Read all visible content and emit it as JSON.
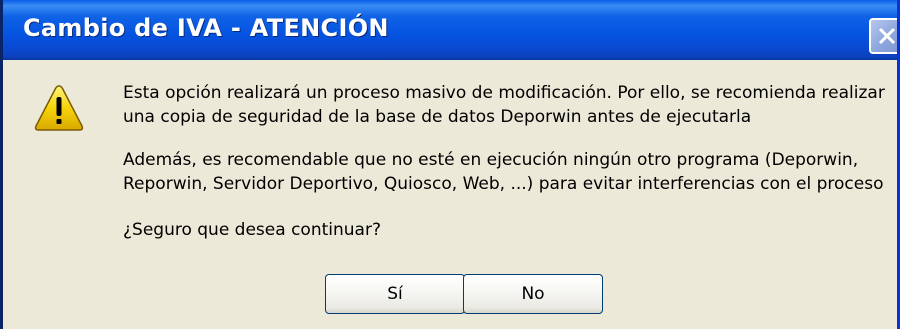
{
  "window": {
    "title": "Cambio de IVA - ATENCIÓN",
    "close_icon": "close-icon"
  },
  "message": {
    "icon": "warning-icon",
    "paragraph1": [
      "Esta opción realizará un proceso masivo de modificación. Por ello, se recomienda realizar",
      "una copia de seguridad de la base de datos Deporwin antes de ejecutarla"
    ],
    "paragraph2": [
      "Además, es recomendable que no esté en ejecución ningún otro programa (Deporwin,",
      "Reporwin, Servidor Deportivo, Quiosco, Web, ...) para evitar interferencias con el proceso"
    ],
    "question": "¿Seguro que desea continuar?"
  },
  "buttons": {
    "yes_label": "Sí",
    "no_label": "No"
  },
  "colors": {
    "titlebar": "#0553e0",
    "dialog_background": "#ece9d8",
    "warning_yellow": "#f7d40a"
  }
}
